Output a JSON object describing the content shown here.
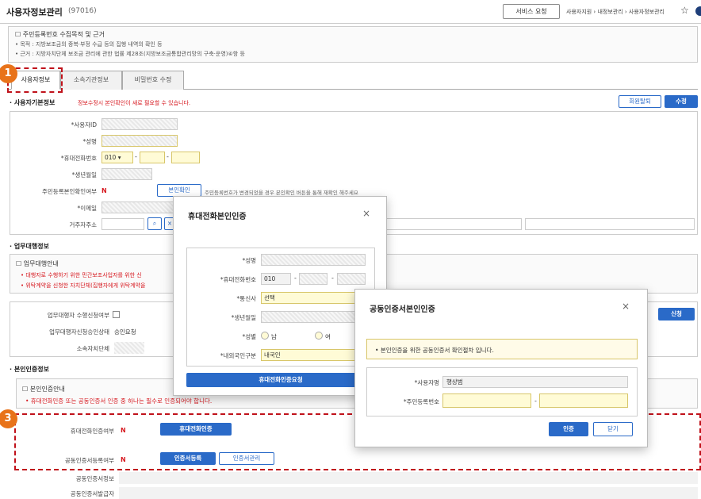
{
  "header": {
    "title": "사용자정보관리",
    "code": "(97016)",
    "service_button": "서비스 요청",
    "breadcrumb": "사용자지원 › 내정보관리 › 사용자정보관리"
  },
  "notice": {
    "title": "주민등록번호 수집목적 및 근거",
    "lines": [
      "• 목적 : 지방보조금의 중복·부정 수급 등의 집행 내역의 확인 등",
      "• 근거 : 지방자치단체 보조금 관리에 관한 법률 제28조(지방보조금통합관리망의 구축·운영)④항 등"
    ]
  },
  "tabs": [
    {
      "label": "사용자정보"
    },
    {
      "label": "소속기관정보"
    },
    {
      "label": "비밀번호 수정"
    }
  ],
  "badges": [
    "1",
    "3"
  ],
  "basic": {
    "title": "· 사용자기본정보",
    "note": "정보수정시 본인확인이 새로 필요할 수 있습니다.",
    "withdraw_button": "회원탈퇴",
    "edit_button": "수정",
    "labels": {
      "user_id": "*사용자ID",
      "name": "*성명",
      "phone": "*휴대전화번호",
      "birth": "*생년월일",
      "rrn_check": "주민등록본인확인여부",
      "email": "*이메일",
      "address": "거주자주소"
    },
    "phone_prefix": "010",
    "rrn_value": "N",
    "identity_button": "본인확인",
    "rrn_note": "주민등록번호가 변경되었을 경우 본인확인 버튼을 통해 재확인 해주세요"
  },
  "proxy": {
    "title": "· 업무대행정보",
    "notice_title": "업무대행안내",
    "lines": [
      "• 대행자로 수행하기 위한 민간보조사업자를 위한 신",
      "• 위탁계약을 신청한 자치단체(집행자에게 위탁계약을"
    ],
    "labels": {
      "apply": "업무대행자 수행신청여부",
      "status": "업무대행자신청승인상태",
      "org": "소속자치단체"
    },
    "status_value": "승인요청",
    "apply_button": "신청"
  },
  "cert": {
    "title": "· 본인인증정보",
    "notice_title": "본인인증안내",
    "notice_line": "• 휴대전화인증 또는 공동인증서 인증 중 하나는 필수로 인증되어야 합니다.",
    "phone_label": "휴대전화인증여부",
    "phone_value": "N",
    "phone_button": "휴대전화인증",
    "cert_label": "공동인증서등록여부",
    "cert_value": "N",
    "cert_register_button": "인증서등록",
    "cert_manage_button": "인증서관리",
    "cert_info_label": "공동인증서정보",
    "cert_issuer_label": "공동인증서발급자"
  },
  "phone_dialog": {
    "title": "휴대전화본인인증",
    "close": "×",
    "labels": {
      "name": "*성명",
      "phone": "*휴대전화번호",
      "carrier": "*통신사",
      "birth": "*생년월일",
      "gender": "*성별",
      "nation": "*내외국인구분"
    },
    "phone_prefix": "010",
    "carrier_value": "선택",
    "male": "남",
    "female": "여",
    "nation_value": "내국인",
    "submit_button": "휴대전화인증요청"
  },
  "cert_dialog": {
    "title": "공동인증서본인인증",
    "close": "×",
    "info": "• 본인인증을 위한 공동인증서 확인절차 입니다.",
    "name_label": "*사용자명",
    "name_value": "행상범",
    "rrn_label": "*주민등록번호",
    "ok_button": "인증",
    "close_button": "닫기"
  },
  "colors": {
    "accent": "#2a6ac8",
    "highlight": "#c0121b",
    "badge": "#e8731a",
    "required": "#d71920"
  }
}
